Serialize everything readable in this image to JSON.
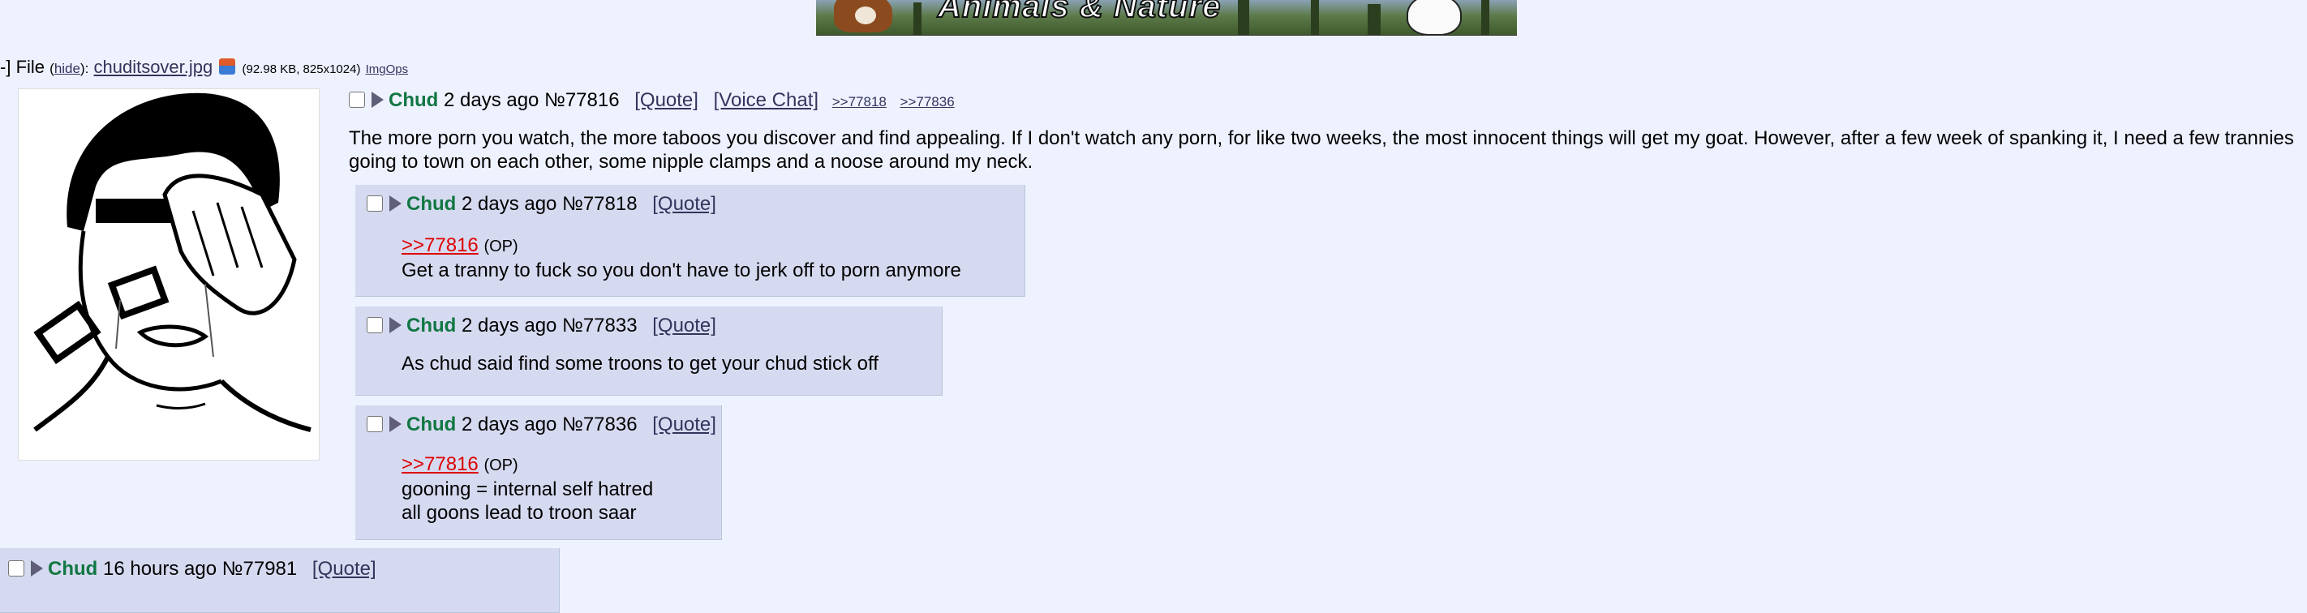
{
  "banner": {
    "text": "Animals & Nature"
  },
  "file": {
    "prefix": "-]",
    "label": "File",
    "hide_open": "(",
    "hide": "hide",
    "hide_close": "):",
    "filename": "chuditsover.jpg",
    "details": "(92.98 KB, 825x1024)",
    "imgops": "ImgOps"
  },
  "op": {
    "name": "Chud",
    "time": "2 days ago",
    "no": "№77816",
    "quote": "[Quote]",
    "voice": "[Voice Chat]",
    "backlinks": [
      ">>77818",
      ">>77836"
    ],
    "text": "The more porn you watch, the more taboos you discover and find appealing. If I don't watch any porn, for like two weeks, the most innocent things will get my goat. However, after a few week of spanking it, I need a few trannies going to town on each other, some nipple clamps and a noose around my neck."
  },
  "replies": [
    {
      "name": "Chud",
      "time": "2 days ago",
      "no": "№77818",
      "quote": "[Quote]",
      "quotelink": ">>77816",
      "op_tag": "(OP)",
      "lines": [
        "Get a tranny to fuck so you don't have to jerk off to porn anymore"
      ]
    },
    {
      "name": "Chud",
      "time": "2 days ago",
      "no": "№77833",
      "quote": "[Quote]",
      "lines": [
        "As chud said find some troons to get your chud stick off"
      ]
    },
    {
      "name": "Chud",
      "time": "2 days ago",
      "no": "№77836",
      "quote": "[Quote]",
      "quotelink": ">>77816",
      "op_tag": "(OP)",
      "lines": [
        "gooning = internal self hatred",
        "all goons lead to troon saar"
      ]
    },
    {
      "name": "Chud",
      "time": "16 hours ago",
      "no": "№77981",
      "quote": "[Quote]"
    }
  ]
}
